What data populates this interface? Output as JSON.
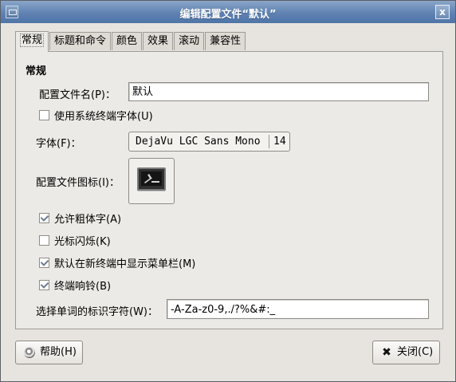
{
  "window": {
    "title": "编辑配置文件“默认”",
    "close_symbol": "x"
  },
  "tabs": [
    {
      "label": "常规"
    },
    {
      "label": "标题和命令"
    },
    {
      "label": "颜色"
    },
    {
      "label": "效果"
    },
    {
      "label": "滚动"
    },
    {
      "label": "兼容性"
    }
  ],
  "general": {
    "section_title": "常规",
    "profile_name_label": "配置文件名(P)：",
    "profile_name_value": "默认",
    "system_font_label": "使用系统终端字体(U)",
    "system_font_checked": false,
    "font_label": "字体(F)：",
    "font_name": "DejaVu LGC Sans Mono",
    "font_size": "14",
    "profile_icon_label": "配置文件图标(I)：",
    "allow_bold_label": "允许粗体字(A)",
    "allow_bold_checked": true,
    "cursor_blink_label": "光标闪烁(K)",
    "cursor_blink_checked": false,
    "show_menubar_label": "默认在新终端中显示菜单栏(M)",
    "show_menubar_checked": true,
    "terminal_bell_label": "终端响铃(B)",
    "terminal_bell_checked": true,
    "word_chars_label": "选择单词的标识字符(W)：",
    "word_chars_value": "-A-Za-z0-9,./?%&#:_"
  },
  "buttons": {
    "help": "帮助(H)",
    "close": "关闭(C)"
  },
  "icons": {
    "window": "terminal-window-icon",
    "profile": "terminal-icon",
    "help": "help-icon",
    "close": "close-icon"
  }
}
